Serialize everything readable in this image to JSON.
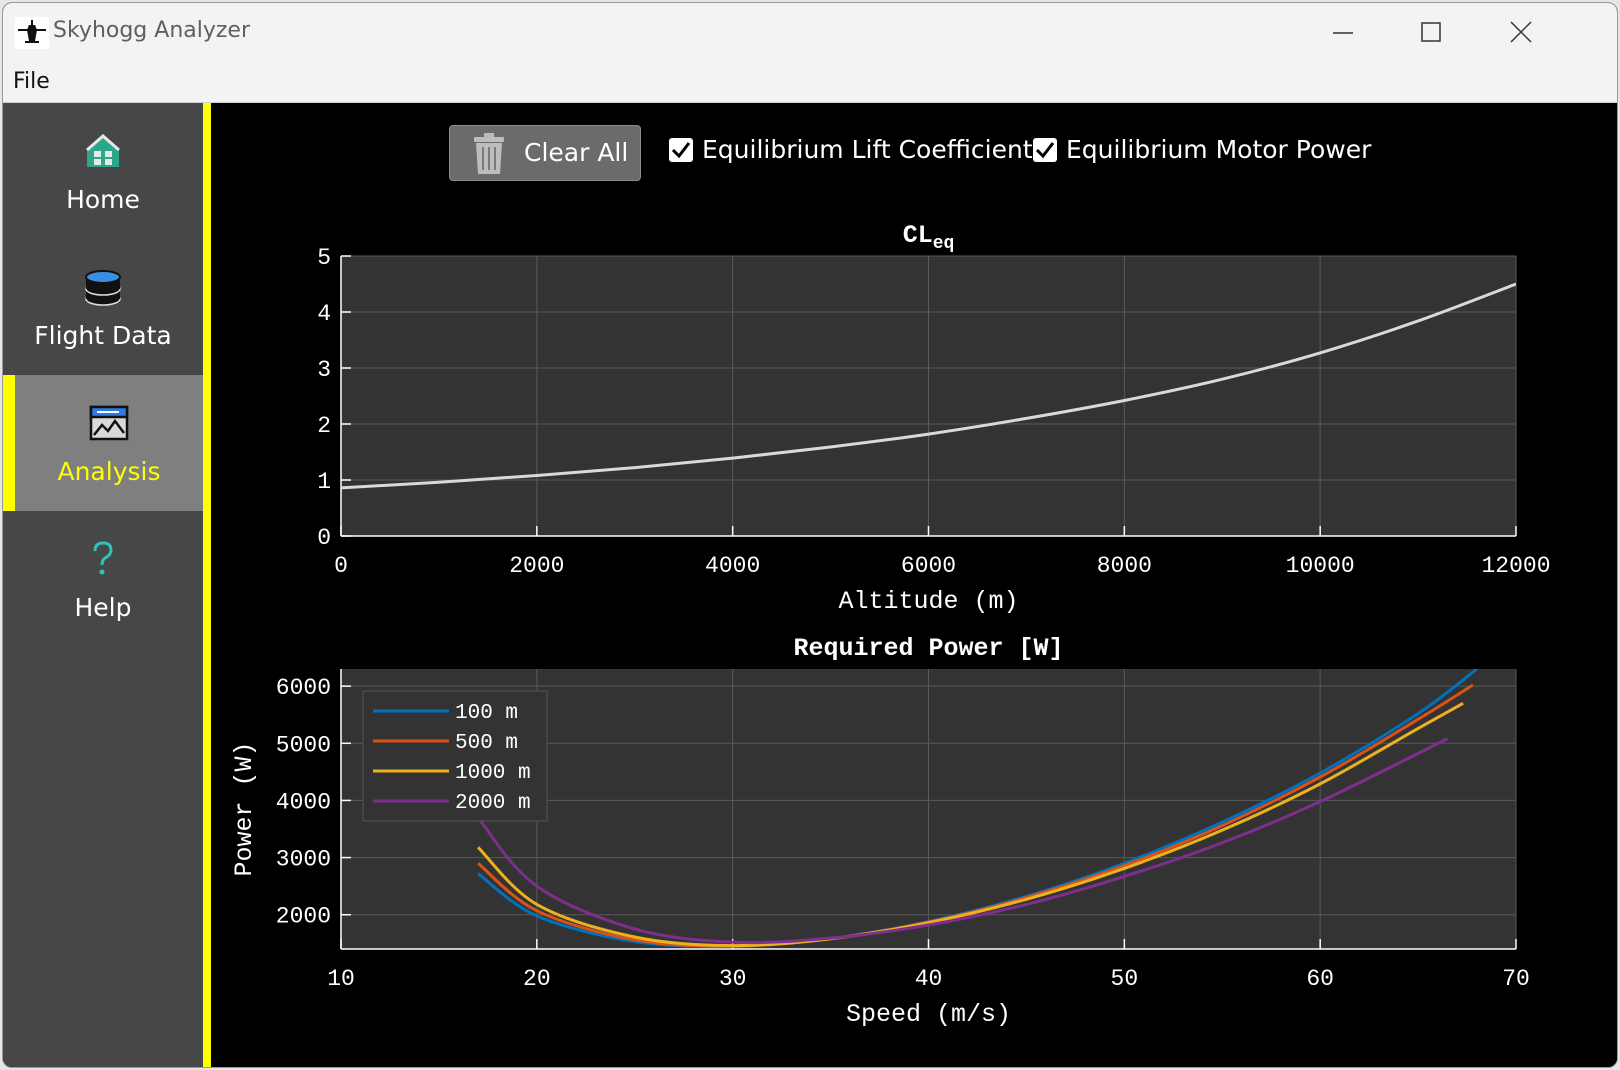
{
  "window": {
    "title": "Skyhogg Analyzer"
  },
  "menu": {
    "file_label": "File"
  },
  "sidebar": {
    "items": [
      {
        "label": "Home",
        "icon": "home-icon"
      },
      {
        "label": "Flight Data",
        "icon": "database-icon"
      },
      {
        "label": "Analysis",
        "icon": "analysis-chart-icon",
        "active": true
      },
      {
        "label": "Help",
        "icon": "question-icon"
      }
    ]
  },
  "toolbar": {
    "clear_label": "Clear All",
    "checkbox_lift_label": "Equilibrium Lift Coefficient",
    "checkbox_lift_checked": true,
    "checkbox_power_label": "Equilibrium Motor Power",
    "checkbox_power_checked": true
  },
  "colors": {
    "accent": "#ffff00",
    "plot_bg": "#333333",
    "sidebar_bg": "#474747"
  },
  "chart_data": [
    {
      "type": "line",
      "title": "CL",
      "title_subscript": "eq",
      "xlabel": "Altitude (m)",
      "ylabel": "",
      "xlim": [
        0,
        12000
      ],
      "ylim": [
        0,
        5
      ],
      "xticks": [
        0,
        2000,
        4000,
        6000,
        8000,
        10000,
        12000
      ],
      "yticks": [
        0,
        1,
        2,
        3,
        4,
        5
      ],
      "grid": true,
      "series": [
        {
          "color": "#d9d9d9",
          "x": [
            0,
            1000,
            2000,
            3000,
            4000,
            5000,
            6000,
            7000,
            8000,
            9000,
            10000,
            11000,
            12000
          ],
          "y": [
            0.86,
            0.96,
            1.08,
            1.22,
            1.39,
            1.59,
            1.82,
            2.1,
            2.42,
            2.8,
            3.27,
            3.84,
            4.5
          ]
        }
      ]
    },
    {
      "type": "line",
      "title": "Required Power [W]",
      "xlabel": "Speed (m/s)",
      "ylabel": "Power (W)",
      "xlim": [
        10,
        70
      ],
      "ylim": [
        1400,
        6300
      ],
      "xticks": [
        10,
        20,
        30,
        40,
        50,
        60,
        70
      ],
      "yticks": [
        2000,
        3000,
        4000,
        5000,
        6000
      ],
      "grid": true,
      "legend": "top-left",
      "series": [
        {
          "name": "100 m",
          "color": "#0072bd",
          "x": [
            17,
            20,
            25,
            30,
            35,
            40,
            45,
            50,
            55,
            60,
            65,
            68
          ],
          "y": [
            2720,
            1980,
            1530,
            1450,
            1580,
            1880,
            2320,
            2900,
            3620,
            4480,
            5520,
            6300
          ]
        },
        {
          "name": "500 m",
          "color": "#d95319",
          "x": [
            17,
            20,
            25,
            30,
            35,
            40,
            45,
            50,
            55,
            60,
            65,
            67.8
          ],
          "y": [
            2900,
            2070,
            1560,
            1450,
            1580,
            1870,
            2300,
            2860,
            3560,
            4410,
            5420,
            6020
          ]
        },
        {
          "name": "1000 m",
          "color": "#edb120",
          "x": [
            17,
            20,
            25,
            30,
            35,
            40,
            45,
            50,
            55,
            60,
            65,
            67.3
          ],
          "y": [
            3180,
            2180,
            1610,
            1460,
            1580,
            1860,
            2270,
            2810,
            3480,
            4290,
            5260,
            5700
          ]
        },
        {
          "name": "2000 m",
          "color": "#7e2f8e",
          "x": [
            15.5,
            17,
            20,
            25,
            30,
            35,
            40,
            45,
            50,
            55,
            60,
            66.5
          ],
          "y": [
            4500,
            3700,
            2500,
            1750,
            1520,
            1590,
            1820,
            2180,
            2670,
            3260,
            3980,
            5080
          ]
        }
      ]
    }
  ]
}
